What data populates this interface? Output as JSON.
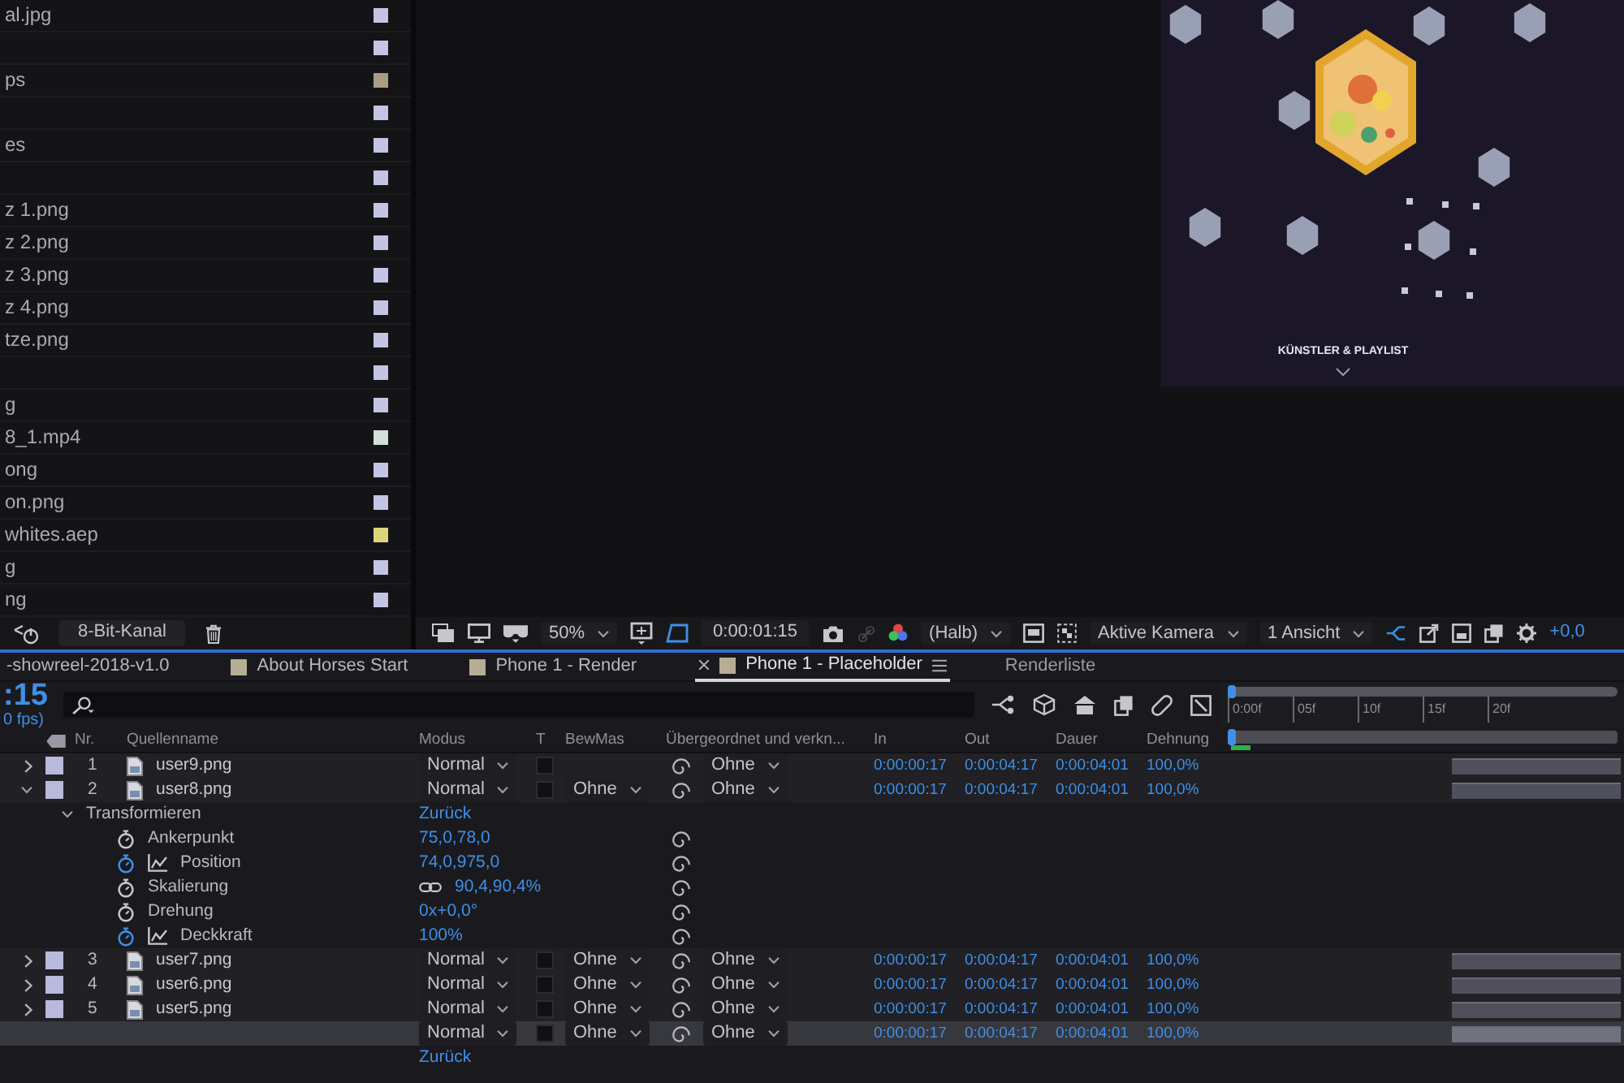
{
  "project_panel": {
    "items": [
      {
        "name": "al.jpg",
        "color": "#c4c4e4"
      },
      {
        "color": "#c4c4e4"
      },
      {
        "name": "ps",
        "color": "#a99d84"
      },
      {
        "color": "#c4c4e4"
      },
      {
        "name": "es",
        "color": "#c4c4e4"
      },
      {
        "color": "#c4c4e4"
      },
      {
        "name": "z 1.png",
        "color": "#c4c4e4"
      },
      {
        "name": "z 2.png",
        "color": "#c4c4e4"
      },
      {
        "name": "z 3.png",
        "color": "#c4c4e4"
      },
      {
        "name": "z 4.png",
        "color": "#c4c4e4"
      },
      {
        "name": "tze.png",
        "color": "#c4c4e4"
      },
      {
        "color": "#c4c4e4"
      },
      {
        "name": "g",
        "color": "#c4c4e4"
      },
      {
        "name": "8_1.mp4",
        "color": "#d2e0dc"
      },
      {
        "name": "ong",
        "color": "#c4c4e4"
      },
      {
        "name": "on.png",
        "color": "#c4c4e4"
      },
      {
        "name": "whites.aep",
        "color": "#dcd679"
      },
      {
        "name": "g",
        "color": "#c4c4e4"
      },
      {
        "name": "ng",
        "color": "#c4c4e4"
      }
    ],
    "bit_depth": "8-Bit-Kanal"
  },
  "viewer": {
    "toolbar": {
      "zoom": "50%",
      "timecode": "0:00:01:15",
      "resolution": "(Halb)",
      "camera": "Aktive Kamera",
      "view_layout": "1 Ansicht",
      "exposure": "+0,0"
    }
  },
  "composition_preview": {
    "caption": "KÜNSTLER & PLAYLIST"
  },
  "timeline": {
    "tabs": [
      {
        "label": "-showreel-2018-v1.0",
        "selected": false
      },
      {
        "label": "About Horses Start",
        "selected": false,
        "color": "#b7ad95"
      },
      {
        "label": "Phone 1 - Render",
        "selected": false,
        "color": "#b7ad95"
      },
      {
        "label": "Phone 1 - Placeholder",
        "selected": true,
        "color": "#b7ad95"
      }
    ],
    "render_queue_tab": "Renderliste",
    "current_time": ":15",
    "frame_rate": "0 fps)",
    "columns": [
      "Nr.",
      "Quellenname",
      "Modus",
      "T",
      "BewMas",
      "Übergeordnet und verkn...",
      "In",
      "Out",
      "Dauer",
      "Dehnung"
    ],
    "ruler": [
      "0:00f",
      "05f",
      "10f",
      "15f",
      "20f"
    ],
    "rows": [
      {
        "kind": "layer",
        "number": "1",
        "name": "user9.png",
        "expanded": false,
        "color": "#b9b9dc",
        "selected": false,
        "mode": "Normal",
        "preserve_transparency": false,
        "parent": "Ohne",
        "in": "0:00:00:17",
        "out": "0:00:04:17",
        "duration": "0:00:04:01",
        "stretch": "100,0%"
      },
      {
        "kind": "layer",
        "number": "2",
        "name": "user8.png",
        "expanded": true,
        "color": "#b9b9dc",
        "selected": false,
        "mode": "Normal",
        "preserve_transparency": false,
        "track_matte": "Ohne",
        "parent": "Ohne",
        "in": "0:00:00:17",
        "out": "0:00:04:17",
        "duration": "0:00:04:01",
        "stretch": "100,0%"
      },
      {
        "kind": "group",
        "name": "Transformieren",
        "expanded": true,
        "value": "Zurück"
      },
      {
        "kind": "property",
        "name": "Ankerpunkt",
        "keyframed": false,
        "value": "75,0,78,0"
      },
      {
        "kind": "property",
        "name": "Position",
        "keyframed": true,
        "value": "74,0,975,0"
      },
      {
        "kind": "property",
        "name": "Skalierung",
        "keyframed": false,
        "constrained": true,
        "value": "90,4,90,4%"
      },
      {
        "kind": "property",
        "name": "Drehung",
        "keyframed": false,
        "value": "0x+0,0°"
      },
      {
        "kind": "property",
        "name": "Deckkraft",
        "keyframed": true,
        "value": "100%"
      },
      {
        "kind": "layer",
        "number": "3",
        "name": "user7.png",
        "expanded": false,
        "color": "#b9b9dc",
        "selected": false,
        "mode": "Normal",
        "preserve_transparency": false,
        "track_matte": "Ohne",
        "parent": "Ohne",
        "in": "0:00:00:17",
        "out": "0:00:04:17",
        "duration": "0:00:04:01",
        "stretch": "100,0%"
      },
      {
        "kind": "layer",
        "number": "4",
        "name": "user6.png",
        "expanded": false,
        "color": "#b9b9dc",
        "selected": false,
        "mode": "Normal",
        "preserve_transparency": false,
        "track_matte": "Ohne",
        "parent": "Ohne",
        "in": "0:00:00:17",
        "out": "0:00:04:17",
        "duration": "0:00:04:01",
        "stretch": "100,0%"
      },
      {
        "kind": "layer",
        "number": "5",
        "name": "user5.png",
        "expanded": false,
        "color": "#b9b9dc",
        "selected": false,
        "mode": "Normal",
        "preserve_transparency": false,
        "track_matte": "Ohne",
        "parent": "Ohne",
        "in": "0:00:00:17",
        "out": "0:00:04:17",
        "duration": "0:00:04:01",
        "stretch": "100,0%"
      },
      {
        "kind": "layer",
        "selected": true,
        "mode": "Normal",
        "preserve_transparency": false,
        "track_matte": "Ohne",
        "parent": "Ohne",
        "in": "0:00:00:17",
        "out": "0:00:04:17",
        "duration": "0:00:04:01",
        "stretch": "100,0%"
      },
      {
        "kind": "group",
        "value": "Zurück"
      }
    ]
  }
}
